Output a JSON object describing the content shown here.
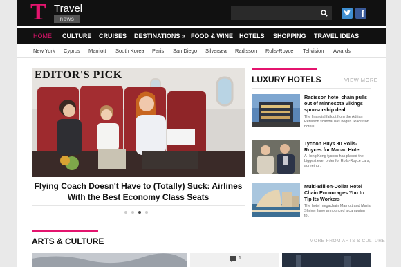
{
  "header": {
    "logo_letter": "T",
    "logo_name": "Travel",
    "logo_tag": "news",
    "search_placeholder": "",
    "search_icon": "search-icon",
    "social": [
      "twitter-icon",
      "facebook-icon"
    ],
    "facebook_glyph": "f"
  },
  "nav": {
    "items": [
      "HOME",
      "CULTURE",
      "CRUISES",
      "DESTINATIONS »",
      "FOOD & WINE",
      "HOTELS",
      "SHOPPING",
      "TRAVEL IDEAS"
    ],
    "active": "HOME",
    "accent": "#e4146e"
  },
  "subnav": {
    "items": [
      "New York",
      "Cyprus",
      "Marriott",
      "South Korea",
      "Paris",
      "San Diego",
      "Silversea",
      "Radisson",
      "Rolls-Royce",
      "Telivision",
      "Awards"
    ]
  },
  "hero": {
    "label": "EDITOR'S PICK",
    "title": "Flying Coach Doesn't Have to (Totally) Suck: Airlines With the Best Economy Class Seats",
    "slides": 4,
    "active_slide": 3
  },
  "luxury": {
    "title": "LUXURY HOTELS",
    "view_more": "VIEW MORE",
    "items": [
      {
        "title": "Radisson hotel chain pulls out of Minnesota Vikings sponsorship deal",
        "excerpt": "The financial fallout from the Adrian Peterson scandal has begun. Radisson hotels..."
      },
      {
        "title": "Tycoon Buys 30 Rolls-Royces for Macau Hotel",
        "excerpt": "A Hong Kong tycoon has placed the biggest ever order for Rolls-Royce cars, agreeing..."
      },
      {
        "title": "Multi-Billion-Dollar Hotel Chain Encourages You to Tip Its Workers",
        "excerpt": "The hotel megachain Marriott and Maria Shriver have announced a campaign to..."
      }
    ]
  },
  "arts": {
    "title": "ARTS & CULTURE",
    "more": "MORE FROM ARTS & CULTURE",
    "comment_count": "1"
  }
}
